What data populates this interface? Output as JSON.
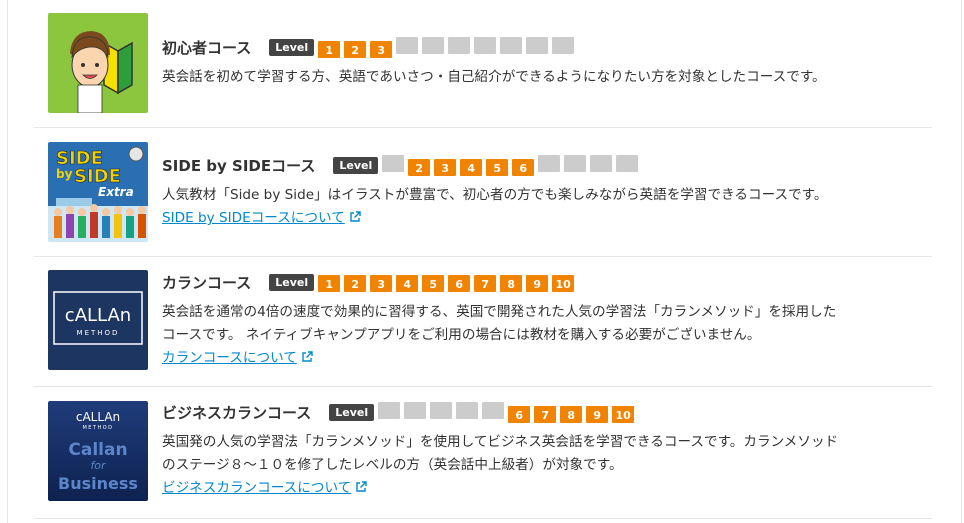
{
  "courses": [
    {
      "title": "初心者コース",
      "level_label": "Level",
      "levels": [
        "1",
        "2",
        "3",
        "",
        "",
        "",
        "",
        "",
        "",
        ""
      ],
      "active": [
        true,
        true,
        true,
        false,
        false,
        false,
        false,
        false,
        false,
        false
      ],
      "description": "英会話を初めて学習する方、英語であいさつ・自己紹介ができるようになりたい方を対象としたコースです。",
      "link": ""
    },
    {
      "title": "SIDE by SIDEコース",
      "level_label": "Level",
      "levels": [
        "",
        "2",
        "3",
        "4",
        "5",
        "6",
        "",
        "",
        "",
        ""
      ],
      "active": [
        false,
        true,
        true,
        true,
        true,
        true,
        false,
        false,
        false,
        false
      ],
      "description": "人気教材「Side by Side」はイラストが豊富で、初心者の方でも楽しみながら英語を学習できるコースです。",
      "link": "SIDE by SIDEコースについて",
      "thumb_text": {
        "line1": "SIDE",
        "line2": "by",
        "line3": "SIDE",
        "badge": "Extra"
      }
    },
    {
      "title": "カランコース",
      "level_label": "Level",
      "levels": [
        "1",
        "2",
        "3",
        "4",
        "5",
        "6",
        "7",
        "8",
        "9",
        "10"
      ],
      "active": [
        true,
        true,
        true,
        true,
        true,
        true,
        true,
        true,
        true,
        true
      ],
      "description_lines": [
        "英会話を通常の4倍の速度で効果的に習得する、英国で開発された人気の学習法「カランメソッド」を採用した",
        "コースです。 ネイティブキャンプアプリをご利用の場合には教材を購入する必要がございません。"
      ],
      "link": "カランコースについて",
      "thumb_text": {
        "brand": "cALLAn",
        "sub": "METHOD"
      }
    },
    {
      "title": "ビジネスカランコース",
      "level_label": "Level",
      "levels": [
        "",
        "",
        "",
        "",
        "",
        "6",
        "7",
        "8",
        "9",
        "10"
      ],
      "active": [
        false,
        false,
        false,
        false,
        false,
        true,
        true,
        true,
        true,
        true
      ],
      "description_lines": [
        "英国発の人気の学習法「カランメソッド」を使用してビジネス英会話を学習できるコースです。カランメソッド",
        "のステージ８～１０を修了したレベルの方（英会話中上級者）が対象です。"
      ],
      "link": "ビジネスカランコースについて",
      "thumb_text": {
        "brand": "cALLAn",
        "sub": "METHOD",
        "word1": "Callan",
        "word2": "for",
        "word3": "Business"
      }
    }
  ],
  "colors": {
    "accent": "#f08300",
    "inactive": "#cccccc",
    "badge": "#444444",
    "link": "#0088cc"
  }
}
